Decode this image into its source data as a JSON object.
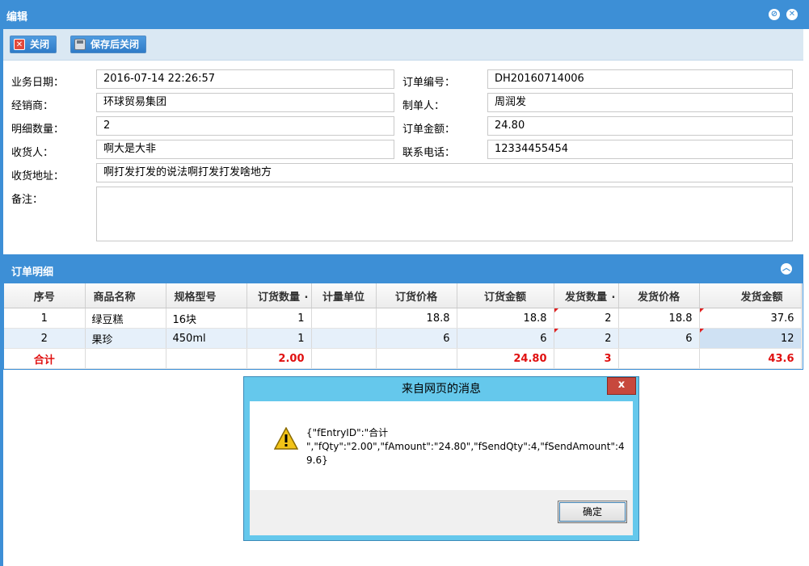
{
  "window": {
    "title": "编辑"
  },
  "toolbar": {
    "close_label": "关闭",
    "save_close_label": "保存后关闭"
  },
  "form": {
    "business_date": {
      "label": "业务日期：",
      "value": "2016-07-14 22:26:57"
    },
    "order_no": {
      "label": "订单编号：",
      "value": "DH20160714006"
    },
    "dealer": {
      "label": "经销商：",
      "value": "环球贸易集团"
    },
    "creator": {
      "label": "制单人：",
      "value": "周润发"
    },
    "detail_count": {
      "label": "明细数量：",
      "value": "2"
    },
    "order_amount": {
      "label": "订单金额：",
      "value": "24.80"
    },
    "receiver": {
      "label": "收货人：",
      "value": "啊大是大非"
    },
    "phone": {
      "label": "联系电话：",
      "value": "12334455454"
    },
    "address": {
      "label": "收货地址：",
      "value": "啊打发打发的说法啊打发打发啥地方"
    },
    "remark": {
      "label": "备注：",
      "value": ""
    }
  },
  "detail": {
    "title": "订单明细",
    "columns": [
      "序号",
      "商品名称",
      "规格型号",
      "订货数量",
      "计量单位",
      "订货价格",
      "订货金额",
      "发货数量",
      "发货价格",
      "发货金额"
    ],
    "rows": [
      [
        "1",
        "绿豆糕",
        "16块",
        "1",
        "",
        "18.8",
        "18.8",
        "2",
        "18.8",
        "37.6"
      ],
      [
        "2",
        "果珍",
        "450ml",
        "1",
        "",
        "6",
        "6",
        "2",
        "6",
        "12"
      ]
    ],
    "total": [
      "合计",
      "",
      "",
      "2.00",
      "",
      "",
      "24.80",
      "3",
      "",
      "43.6"
    ]
  },
  "dialog": {
    "title": "来自网页的消息",
    "close": "x",
    "message": "{\"fEntryID\":\"合计\n\",\"fQty\":\"2.00\",\"fAmount\":\"24.80\",\"fSendQty\":4,\"fSendAmount\":49.6}",
    "ok_label": "确定"
  },
  "colors": {
    "accent": "#3d8fd6",
    "total_text": "#e01010",
    "dialog_frame": "#65c8ec"
  }
}
